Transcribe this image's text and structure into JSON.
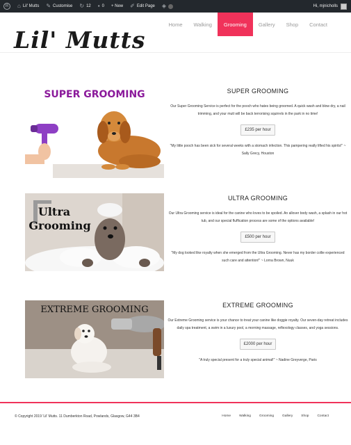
{
  "adminbar": {
    "wp_icon": "W",
    "site_name": "Lil' Mutts",
    "customise": "Customise",
    "updates_count": "12",
    "comments_count": "0",
    "new_label": "+ New",
    "edit_page": "Edit Page",
    "greeting": "Hi, mjnicholls"
  },
  "header": {
    "logo": "Lil' Mutts",
    "nav": [
      "Home",
      "Walking",
      "Grooming",
      "Gallery",
      "Shop",
      "Contact"
    ],
    "active_nav": "Grooming"
  },
  "services": [
    {
      "image_text": "SUPER GROOMING",
      "title": "SUPER GROOMING",
      "description": "Our Super Grooming Service is perfect for the pooch who hates being groomed. A quick wash and blow dry, a nail trimming, and your mutt will be back terrorising squirrels in the park in no time!",
      "price": "£235 per hour",
      "quote": "\"My little pooch has been sick for several weeks with a stomach infection. This pampering really lifted his spirits!\" ~ Sally Grecy, Houston"
    },
    {
      "image_text_line1": "Ultra",
      "image_text_line2": "Grooming",
      "title": "ULTRA GROOMING",
      "description": "Our Ultra Grooming service is ideal for the canine who loves to be spoiled. An allover body wash, a splash in our hot tub, and our special fluffication process are some of the options available!",
      "price": "£500 per hour",
      "quote": "\"My dog looked like royalty when she emerged from the Ultra Grooming. Never has my border collie experienced such care and attention!\" ~ Lorna Brown, Nuuk"
    },
    {
      "image_text": "EXTREME GROOMING",
      "title": "EXTREME GROOMING",
      "description": "Our Extreme Grooming service is your chance to treat your canine like doggie royalty. Our seven-day retreat includes daily spa treatment, a swim in a luxury pool, a morning massage, reflexology classes, and yoga sessions.",
      "price": "£2000 per hour",
      "quote": "\"A truly special present for a truly special animal!\" ~ Nadine Greyverge, Paris"
    }
  ],
  "footer": {
    "copyright": "© Copyright 2019 'Lil' Mutts. 11 Dumberkton Road, Powlands, Glasgow, G44 3B4",
    "nav": [
      "Home",
      "Walking",
      "Grooming",
      "Gallery",
      "Shop",
      "Contact"
    ]
  },
  "colors": {
    "accent": "#f0325a",
    "adminbar": "#23282d",
    "super_title": "#8b1a9b"
  },
  "icons": [
    "wordpress-icon",
    "home-icon",
    "brush-icon",
    "refresh-icon",
    "comment-icon",
    "pencil-icon",
    "avatar-icon"
  ]
}
